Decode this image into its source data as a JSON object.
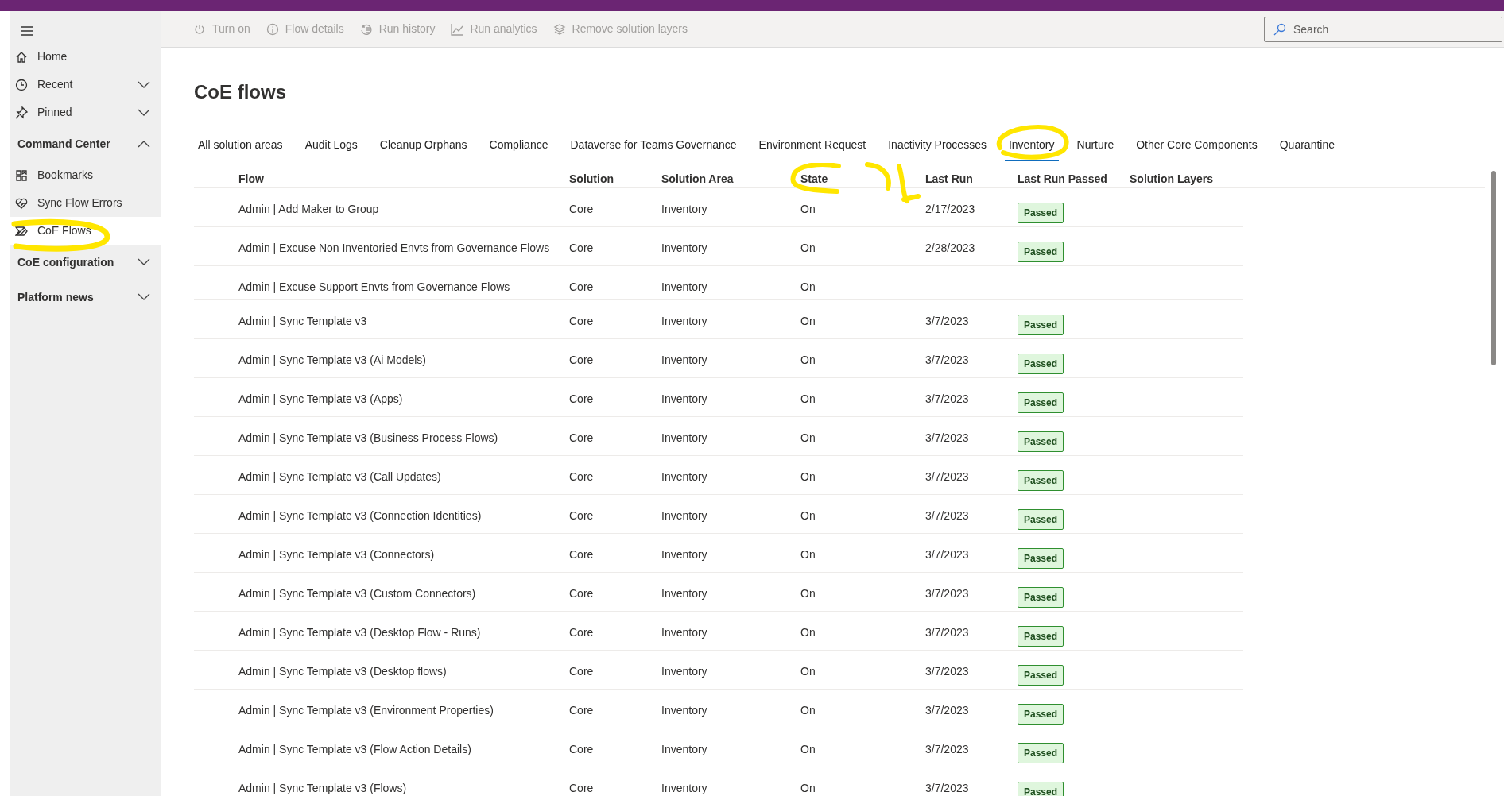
{
  "toolbar": [
    {
      "kind": "power",
      "label": "Turn on"
    },
    {
      "kind": "info",
      "label": "Flow details"
    },
    {
      "kind": "history",
      "label": "Run history"
    },
    {
      "kind": "analytics",
      "label": "Run analytics"
    },
    {
      "kind": "layers",
      "label": "Remove solution layers"
    }
  ],
  "search": {
    "placeholder": "Search"
  },
  "sidebar": {
    "items": [
      {
        "kind": "link",
        "label": "Home",
        "selected": false
      },
      {
        "kind": "link",
        "label": "Recent",
        "selected": false,
        "expanded": false
      },
      {
        "kind": "link",
        "label": "Pinned",
        "selected": false,
        "expanded": false
      },
      {
        "kind": "group",
        "label": "Command Center",
        "expanded": true,
        "children": [
          {
            "label": "Bookmarks",
            "selected": false
          },
          {
            "label": "Sync Flow Errors",
            "selected": false
          },
          {
            "label": "CoE Flows",
            "selected": true
          }
        ]
      },
      {
        "kind": "group",
        "label": "CoE configuration",
        "expanded": false
      },
      {
        "kind": "group",
        "label": "Platform news",
        "expanded": false
      }
    ]
  },
  "page_title": "CoE flows",
  "tabs": [
    {
      "label": "All solution areas",
      "selected": false
    },
    {
      "label": "Audit Logs",
      "selected": false
    },
    {
      "label": "Cleanup Orphans",
      "selected": false
    },
    {
      "label": "Compliance",
      "selected": false
    },
    {
      "label": "Dataverse for Teams Governance",
      "selected": false
    },
    {
      "label": "Environment Request",
      "selected": false
    },
    {
      "label": "Inactivity Processes",
      "selected": false
    },
    {
      "label": "Inventory",
      "selected": true
    },
    {
      "label": "Nurture",
      "selected": false
    },
    {
      "label": "Other Core Components",
      "selected": false
    },
    {
      "label": "Quarantine",
      "selected": false
    }
  ],
  "table": {
    "columns": [
      "Flow",
      "Solution",
      "Solution Area",
      "State",
      "Last Run",
      "Last Run Passed",
      "Solution Layers"
    ],
    "rows": [
      {
        "flow": "Admin | Add Maker to Group",
        "solution": "Core",
        "area": "Inventory",
        "state": "On",
        "last_run": "2/17/2023",
        "passed": "Passed"
      },
      {
        "flow": "Admin | Excuse Non Inventoried Envts from Governance Flows",
        "solution": "Core",
        "area": "Inventory",
        "state": "On",
        "last_run": "2/28/2023",
        "passed": "Passed"
      },
      {
        "flow": "Admin | Excuse Support Envts from Governance Flows",
        "solution": "Core",
        "area": "Inventory",
        "state": "On"
      },
      {
        "flow": "Admin | Sync Template v3",
        "solution": "Core",
        "area": "Inventory",
        "state": "On",
        "last_run": "3/7/2023",
        "passed": "Passed"
      },
      {
        "flow": "Admin | Sync Template v3 (Ai Models)",
        "solution": "Core",
        "area": "Inventory",
        "state": "On",
        "last_run": "3/7/2023",
        "passed": "Passed"
      },
      {
        "flow": "Admin | Sync Template v3 (Apps)",
        "solution": "Core",
        "area": "Inventory",
        "state": "On",
        "last_run": "3/7/2023",
        "passed": "Passed"
      },
      {
        "flow": "Admin | Sync Template v3 (Business Process Flows)",
        "solution": "Core",
        "area": "Inventory",
        "state": "On",
        "last_run": "3/7/2023",
        "passed": "Passed"
      },
      {
        "flow": "Admin | Sync Template v3 (Call Updates)",
        "solution": "Core",
        "area": "Inventory",
        "state": "On",
        "last_run": "3/7/2023",
        "passed": "Passed"
      },
      {
        "flow": "Admin | Sync Template v3 (Connection Identities)",
        "solution": "Core",
        "area": "Inventory",
        "state": "On",
        "last_run": "3/7/2023",
        "passed": "Passed"
      },
      {
        "flow": "Admin | Sync Template v3 (Connectors)",
        "solution": "Core",
        "area": "Inventory",
        "state": "On",
        "last_run": "3/7/2023",
        "passed": "Passed"
      },
      {
        "flow": "Admin | Sync Template v3 (Custom Connectors)",
        "solution": "Core",
        "area": "Inventory",
        "state": "On",
        "last_run": "3/7/2023",
        "passed": "Passed"
      },
      {
        "flow": "Admin | Sync Template v3 (Desktop Flow - Runs)",
        "solution": "Core",
        "area": "Inventory",
        "state": "On",
        "last_run": "3/7/2023",
        "passed": "Passed"
      },
      {
        "flow": "Admin | Sync Template v3 (Desktop flows)",
        "solution": "Core",
        "area": "Inventory",
        "state": "On",
        "last_run": "3/7/2023",
        "passed": "Passed"
      },
      {
        "flow": "Admin | Sync Template v3 (Environment Properties)",
        "solution": "Core",
        "area": "Inventory",
        "state": "On",
        "last_run": "3/7/2023",
        "passed": "Passed"
      },
      {
        "flow": "Admin | Sync Template v3 (Flow Action Details)",
        "solution": "Core",
        "area": "Inventory",
        "state": "On",
        "last_run": "3/7/2023",
        "passed": "Passed"
      },
      {
        "flow": "Admin | Sync Template v3 (Flows)",
        "solution": "Core",
        "area": "Inventory",
        "state": "On",
        "last_run": "3/7/2023",
        "passed": "Passed"
      }
    ]
  }
}
